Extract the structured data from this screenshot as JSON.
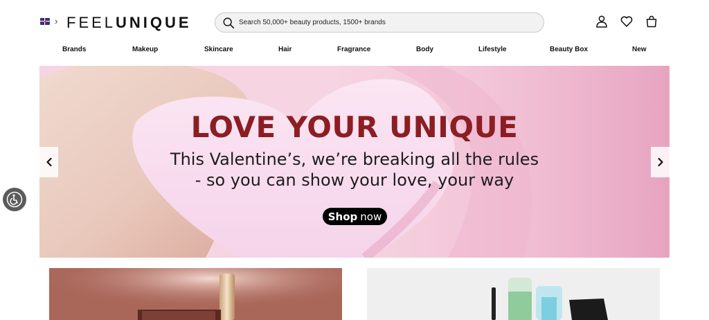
{
  "header": {
    "logo_part1": "FEEL",
    "logo_part2": "UNIQUE",
    "search_placeholder": "Search 50,000+ beauty products, 1500+ brands",
    "icons": [
      "flag-uk-icon",
      "chevron-right-icon",
      "search-icon",
      "account-icon",
      "heart-icon",
      "bag-icon"
    ]
  },
  "nav": {
    "items": [
      "Brands",
      "Makeup",
      "Skincare",
      "Hair",
      "Fragrance",
      "Body",
      "Lifestyle",
      "Beauty Box",
      "New"
    ]
  },
  "hero": {
    "title": "LOVE YOUR UNIQUE",
    "subtitle_line1": "This Valentine’s, we’re breaking all the rules",
    "subtitle_line2": "- so you can show your love, your way",
    "button_bold": "Shop",
    "button_rest": "now",
    "colors": {
      "title": "#8b1e23",
      "background": "#f3c4d6"
    }
  }
}
